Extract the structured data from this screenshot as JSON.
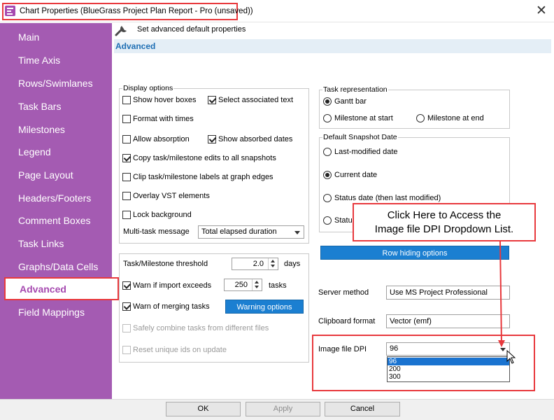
{
  "window": {
    "title": "Chart Properties (BlueGrass Project Plan Report - Pro (unsaved))",
    "close_glyph": "✕",
    "app_icon": "chart-properties-icon"
  },
  "sidebar": {
    "items": [
      {
        "label": "Main"
      },
      {
        "label": "Time Axis"
      },
      {
        "label": "Rows/Swimlanes"
      },
      {
        "label": "Task Bars"
      },
      {
        "label": "Milestones"
      },
      {
        "label": "Legend"
      },
      {
        "label": "Page Layout"
      },
      {
        "label": "Headers/Footers"
      },
      {
        "label": "Comment Boxes"
      },
      {
        "label": "Task Links"
      },
      {
        "label": "Graphs/Data Cells"
      },
      {
        "label": "Advanced"
      },
      {
        "label": "Field Mappings"
      }
    ],
    "selected": "Advanced",
    "accent_color": "#a45bb2"
  },
  "header": {
    "hint": "Set advanced default properties",
    "section_title": "Advanced"
  },
  "display_options": {
    "group_label": "Display options",
    "show_hover_boxes": {
      "label": "Show hover boxes",
      "checked": false
    },
    "select_associated_text": {
      "label": "Select associated text",
      "checked": true
    },
    "format_with_times": {
      "label": "Format with times",
      "checked": false
    },
    "allow_absorption": {
      "label": "Allow absorption",
      "checked": false
    },
    "show_absorbed_dates": {
      "label": "Show absorbed dates",
      "checked": true
    },
    "copy_edits": {
      "label": "Copy task/milestone edits to all snapshots",
      "checked": true
    },
    "clip_labels": {
      "label": "Clip task/milestone labels at graph edges",
      "checked": false
    },
    "overlay_vst": {
      "label": "Overlay VST elements",
      "checked": false
    },
    "lock_background": {
      "label": "Lock background",
      "checked": false
    },
    "multitask_label": "Multi-task message",
    "multitask_value": "Total elapsed duration"
  },
  "threshold": {
    "threshold_label": "Task/Milestone threshold",
    "threshold_value": "2.0",
    "threshold_unit": "days",
    "warn_import": {
      "label": "Warn if import exceeds",
      "checked": true
    },
    "import_value": "250",
    "import_unit": "tasks",
    "warn_merging": {
      "label": "Warn of merging tasks",
      "checked": true
    },
    "warning_options_button": "Warning options",
    "safely_combine": {
      "label": "Safely combine tasks from different files",
      "checked": false,
      "disabled": true
    },
    "reset_ids": {
      "label": "Reset unique ids on update",
      "checked": false,
      "disabled": true
    }
  },
  "task_representation": {
    "group_label": "Task representation",
    "gantt_bar": "Gantt bar",
    "milestone_at_start": "Milestone at start",
    "milestone_at_end": "Milestone at end",
    "selected": "Gantt bar"
  },
  "snapshot_date": {
    "group_label": "Default Snapshot Date",
    "last_modified": "Last-modified date",
    "current_date": "Current date",
    "status_then_last": "Status date (then last modified)",
    "status_partial": "Statu",
    "selected": "Current date"
  },
  "row_hiding_button": "Row hiding options",
  "server_method": {
    "label": "Server method",
    "value": "Use MS Project Professional"
  },
  "clipboard_format": {
    "label": "Clipboard format",
    "value": "Vector (emf)"
  },
  "image_dpi": {
    "label": "Image file DPI",
    "value": "96",
    "options": [
      "96",
      "200",
      "300"
    ],
    "highlighted": "96"
  },
  "callout": {
    "line1": "Click Here to Access the",
    "line2": "Image file DPI Dropdown List.",
    "color": "#e8393d"
  },
  "footer": {
    "ok": "OK",
    "apply": "Apply",
    "cancel": "Cancel"
  }
}
